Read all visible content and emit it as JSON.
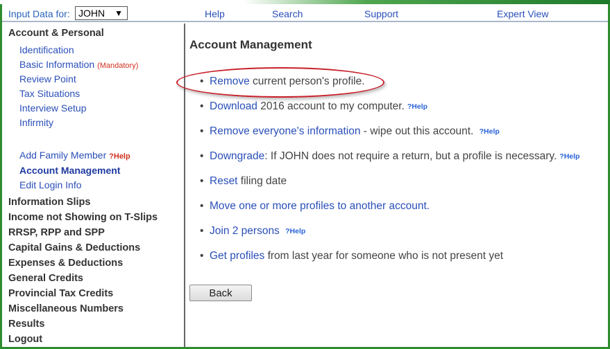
{
  "topbar": {
    "input_for_label": "Input Data for:",
    "selected_person": "JOHN",
    "links": {
      "help": "Help",
      "search": "Search",
      "support": "Support",
      "expert_view": "Expert View"
    }
  },
  "sidebar": {
    "section_account": "Account & Personal",
    "items_account": [
      "Identification",
      "Basic Information",
      "Review Point",
      "Tax Situations",
      "Interview Setup",
      "Infirmity"
    ],
    "mandatory_tag": "(Mandatory)",
    "items_family": {
      "add_family_member": "Add Family Member",
      "help_tag": "?Help",
      "account_management": "Account Management",
      "edit_login_info": "Edit Login Info"
    },
    "sections": [
      "Information Slips",
      "Income not Showing on T-Slips",
      "RRSP, RPP and SPP",
      "Capital Gains & Deductions",
      "Expenses & Deductions",
      "General Credits",
      "Provincial Tax Credits",
      "Miscellaneous Numbers",
      "Results",
      "Logout"
    ]
  },
  "main": {
    "title": "Account Management",
    "help_label": "?Help",
    "items": [
      {
        "link": "Remove",
        "text": " current person's profile."
      },
      {
        "link": "Download",
        "text": " 2016 account to my computer."
      },
      {
        "link": "Remove everyone's information",
        "text": " - wipe out this account."
      },
      {
        "link": "Downgrade",
        "text": ": If JOHN does not require a return, but a profile is necessary."
      },
      {
        "link": "Reset",
        "text": " filing date"
      },
      {
        "link": "Move one or more profiles to another account.",
        "text": ""
      },
      {
        "link": "Join 2 persons",
        "text": ""
      },
      {
        "link": "Get profiles",
        "text": " from last year for someone who is not present yet"
      }
    ],
    "back_label": "Back"
  },
  "colors": {
    "frame_border": "#2e8b2e",
    "link_blue": "#2a4fb8",
    "annotation_red": "#c8202a",
    "mandatory_red": "#d03020"
  }
}
